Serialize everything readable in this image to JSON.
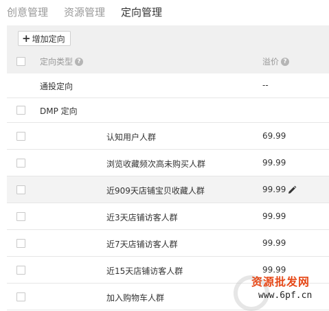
{
  "tabs": [
    {
      "label": "创意管理",
      "active": false
    },
    {
      "label": "资源管理",
      "active": false
    },
    {
      "label": "定向管理",
      "active": true
    }
  ],
  "toolbar": {
    "add_label": "增加定向"
  },
  "table": {
    "col_type": "定向类型",
    "col_price": "溢价",
    "rows": [
      {
        "name": "通投定向",
        "price": "--",
        "checkbox": false,
        "indent": 0,
        "highlight": false,
        "editable": false
      },
      {
        "name": "DMP 定向",
        "price": "",
        "checkbox": true,
        "indent": 0,
        "highlight": false,
        "editable": false
      },
      {
        "name": "认知用户人群",
        "price": "69.99",
        "checkbox": true,
        "indent": 1,
        "highlight": false,
        "editable": false
      },
      {
        "name": "浏览收藏频次高未购买人群",
        "price": "99.99",
        "checkbox": true,
        "indent": 1,
        "highlight": false,
        "editable": false
      },
      {
        "name": "近909天店铺宝贝收藏人群",
        "price": "99.99",
        "checkbox": true,
        "indent": 1,
        "highlight": true,
        "editable": true
      },
      {
        "name": "近3天店铺访客人群",
        "price": "99.99",
        "checkbox": true,
        "indent": 1,
        "highlight": false,
        "editable": false
      },
      {
        "name": "近7天店铺访客人群",
        "price": "99.99",
        "checkbox": true,
        "indent": 1,
        "highlight": false,
        "editable": false
      },
      {
        "name": "近15天店铺访客人群",
        "price": "99.99",
        "checkbox": true,
        "indent": 1,
        "highlight": false,
        "editable": false
      },
      {
        "name": "加入购物车人群",
        "price": "",
        "checkbox": true,
        "indent": 1,
        "highlight": false,
        "editable": false
      }
    ]
  },
  "watermark": {
    "title": "资源批发网",
    "url": "www.6pf.cn"
  },
  "icons": {
    "add": "plus-icon",
    "help": "question-circle-icon",
    "edit": "pencil-icon"
  }
}
